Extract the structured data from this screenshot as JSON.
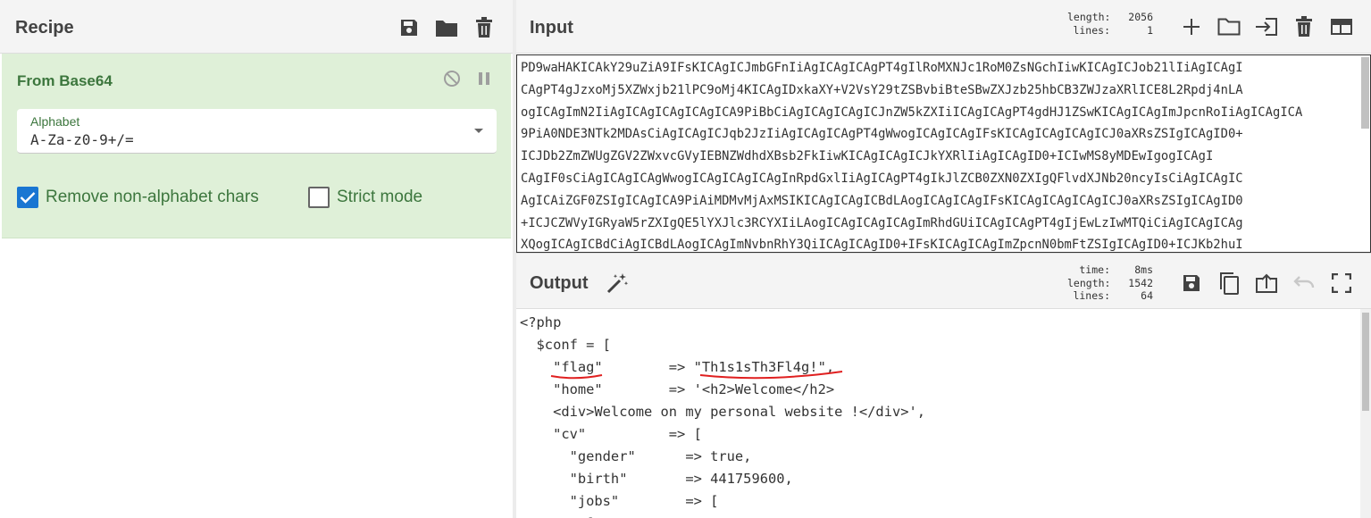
{
  "recipe": {
    "title": "Recipe",
    "header_icons": [
      "save-icon",
      "folder-icon",
      "trash-icon"
    ],
    "operation": {
      "name": "From Base64",
      "alphabet_label": "Alphabet",
      "alphabet_value": "A-Za-z0-9+/=",
      "remove_nonalpha_label": "Remove non-alphabet chars",
      "remove_nonalpha_checked": true,
      "strict_mode_label": "Strict mode",
      "strict_mode_checked": false
    }
  },
  "input": {
    "title": "Input",
    "stats": {
      "length_label": "length:",
      "length": "2056",
      "lines_label": "lines:",
      "lines": "1"
    },
    "text_lines": [
      "PD9waHAKICAkY29uZiA9IFsKICAgICJmbGFnIiAgICAgICAgPT4gIlRoMXNJc1RoM0ZsNGchIiwKICAgICJob21lIiAgICAgI",
      "CAgPT4gJzxoMj5XZWxjb21lPC9oMj4KICAgIDxkaXY+V2VsY29tZSBvbiBteSBwZXJzb25hbCB3ZWJzaXRlICE8L2Rpdj4nLA",
      "ogICAgImN2IiAgICAgICAgICAgICA9PiBbCiAgICAgICAgICJnZW5kZXIiICAgICAgPT4gdHJ1ZSwKICAgICAgImJpcnRoIiAgICAgICA",
      "9PiA0NDE3NTk2MDAsCiAgICAgICJqb2JzIiAgICAgICAgPT4gWwogICAgICAgIFsKICAgICAgICAgICJ0aXRsZSIgICAgID0+",
      "ICJDb2ZmZWUgZGV2ZWxvcGVyIEBNZWdhdXBsb2FkIiwKICAgICAgICJkYXRlIiAgICAgID0+ICIwMS8yMDEwIgogICAgI",
      "CAgIF0sCiAgICAgICAgWwogICAgICAgICAgInRpdGxlIiAgICAgPT4gIkJlZCB0ZXN0ZXIgQFlvdXJNb20ncyIsCiAgICAgIC",
      "AgICAiZGF0ZSIgICAgICA9PiAiMDMvMjAxMSIKICAgICAgICBdLAogICAgICAgIFsKICAgICAgICAgICJ0aXRsZSIgICAgID0",
      "+ICJCZWVyIGRyaW5rZXIgQE5lYXJlc3RCYXIiLAogICAgICAgICAgImRhdGUiICAgICAgPT4gIjEwLzIwMTQiCiAgICAgICAg",
      "XQogICAgICBdCiAgICBdLAogICAgImNvbnRhY3QiICAgICAgID0+IFsKICAgICAgImZpcnN0bmFtZSIgICAgID0+ICJKb2huI"
    ],
    "icons": [
      "plus-icon",
      "folder-icon",
      "load-file-icon",
      "trash-icon",
      "layout-icon"
    ]
  },
  "output": {
    "title": "Output",
    "stats": {
      "time_label": "time:",
      "time": "8ms",
      "length_label": "length:",
      "length": "1542",
      "lines_label": "lines:",
      "lines": "64"
    },
    "text_lines": [
      "<?php",
      "  $conf = [",
      "    \"flag\"        => \"Th1s1sTh3Fl4g!\",",
      "    \"home\"        => '<h2>Welcome</h2>",
      "    <div>Welcome on my personal website !</div>',",
      "    \"cv\"          => [",
      "      \"gender\"      => true,",
      "      \"birth\"       => 441759600,",
      "      \"jobs\"        => [",
      "        ["
    ],
    "icons": [
      "save-icon",
      "copy-icon",
      "move-to-input-icon",
      "undo-icon",
      "maximize-icon"
    ]
  }
}
